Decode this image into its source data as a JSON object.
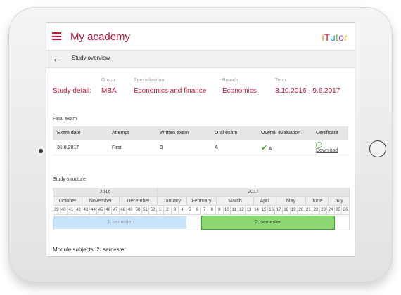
{
  "app": {
    "title": "My academy",
    "logo": "iTutor",
    "logo_colors": [
      "#e8871e",
      "#c0163a",
      "#2a8fd8",
      "#6abf3b",
      "#8b4bb3",
      "#e8b21e"
    ]
  },
  "nav": {
    "back_icon": "arrow-left-icon",
    "page_title": "Study overview",
    "menu_icon": "hamburger-icon"
  },
  "study_detail": {
    "label": "Study detail:",
    "fields": [
      {
        "caption": "Group",
        "value": "MBA"
      },
      {
        "caption": "Specialization",
        "value": "Economics and finance"
      },
      {
        "caption": "Branch",
        "value": "Economics"
      },
      {
        "caption": "Term",
        "value": "3.10.2016 - 9.6.2017"
      }
    ]
  },
  "final_exam": {
    "title": "Final exam",
    "headers": [
      "Exam date",
      "Attempt",
      "Written exam",
      "Oral exam",
      "Overall evaluation",
      "Certificate"
    ],
    "row": {
      "date": "31.8.2017",
      "attempt": "First",
      "written": "B",
      "oral": "A",
      "overall": "A",
      "certificate": "Download"
    }
  },
  "study_structure": {
    "title": "Study structure",
    "years": [
      "2016",
      "2017"
    ],
    "months": [
      "October",
      "November",
      "December",
      "January",
      "February",
      "March",
      "April",
      "May",
      "June",
      "July"
    ],
    "weeks": [
      "39",
      "40",
      "41",
      "42",
      "43",
      "44",
      "45",
      "46",
      "47",
      "48",
      "49",
      "50",
      "51",
      "52",
      "1",
      "2",
      "3",
      "4",
      "5",
      "6",
      "7",
      "8",
      "9",
      "10",
      "11",
      "12",
      "13",
      "14",
      "15",
      "16",
      "17",
      "18",
      "19",
      "20",
      "21",
      "22",
      "23",
      "24",
      "25",
      "26"
    ],
    "semesters": [
      {
        "label": "1. semester",
        "state": "past"
      },
      {
        "label": "2. semester",
        "state": "current"
      }
    ]
  },
  "module_subjects": "Module subjects: 2. semester",
  "colors": {
    "accent": "#c0163a",
    "current_semester": "#8ed873",
    "past_semester": "#c8e2f8"
  }
}
